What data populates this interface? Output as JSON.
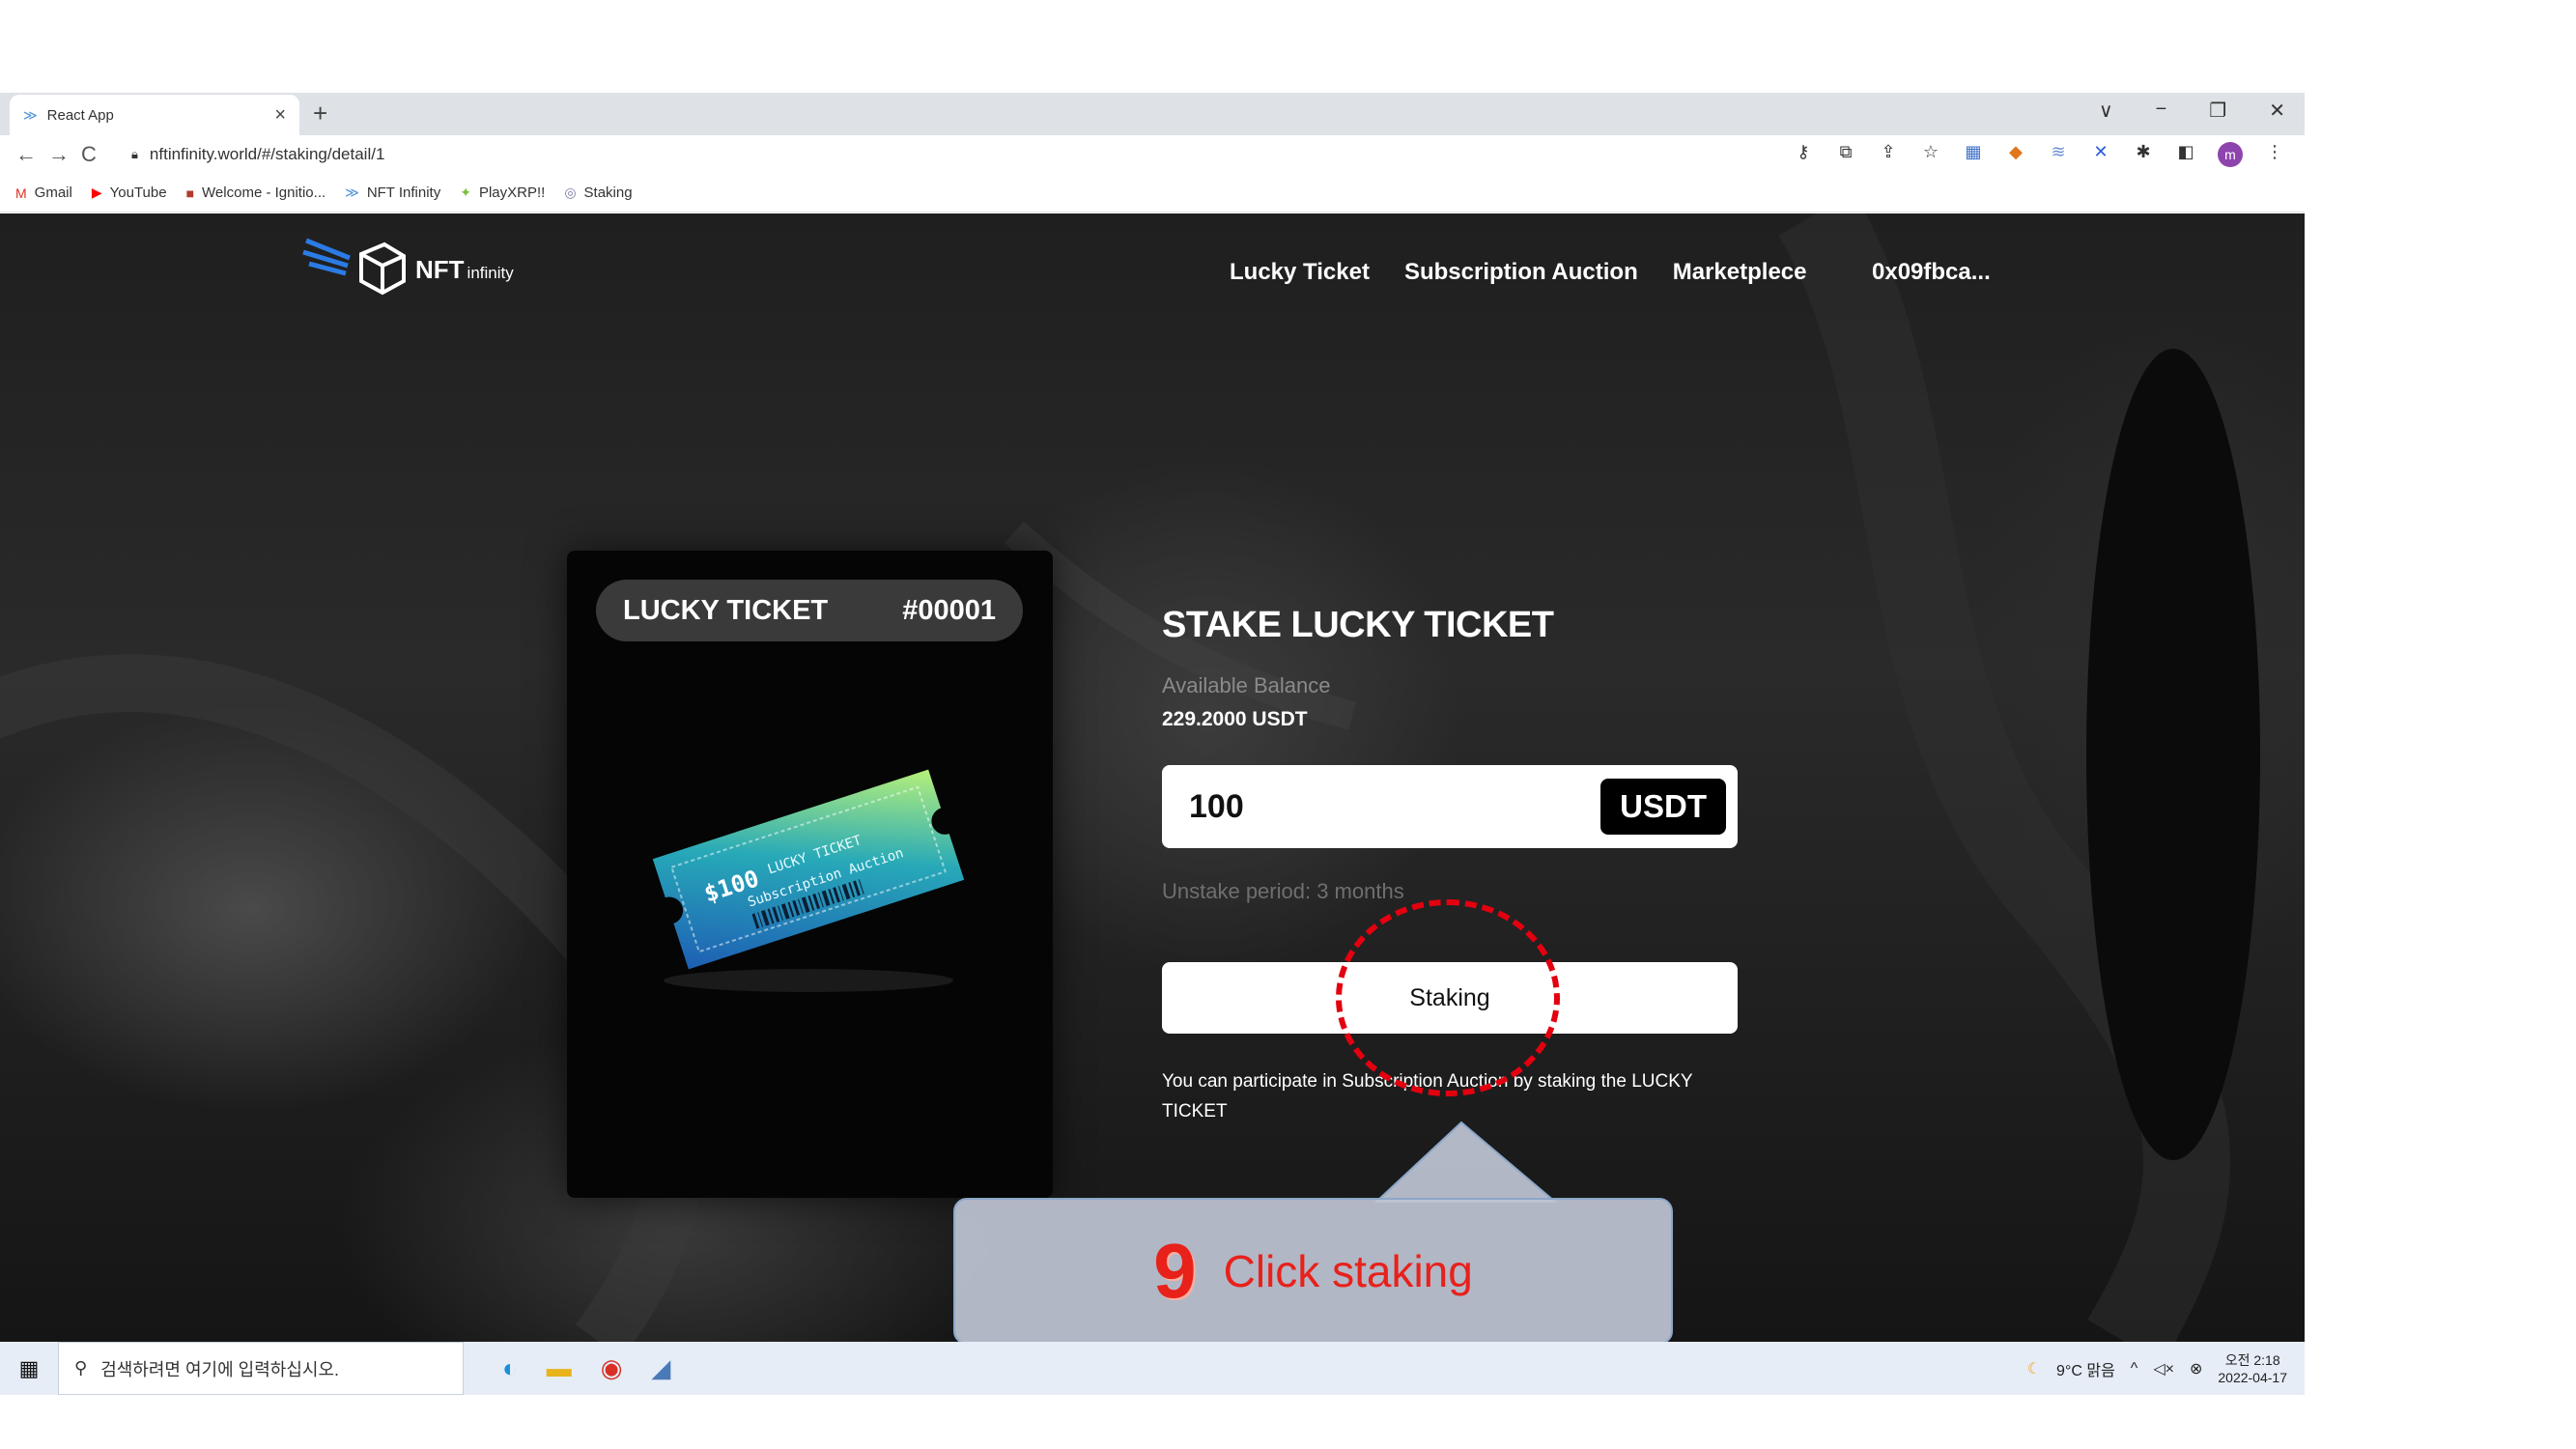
{
  "browser": {
    "tab_title": "React App",
    "tab_close": "×",
    "new_tab": "+",
    "window_controls": [
      "∨",
      "−",
      "❐",
      "✕"
    ],
    "url": "nftinfinity.world/#/staking/detail/1",
    "nav": {
      "back": "←",
      "forward": "→",
      "reload": "C"
    },
    "bookmarks": [
      {
        "label": "Gmail",
        "icon": "gmail-icon",
        "glyph": "M",
        "color": "#d93025"
      },
      {
        "label": "YouTube",
        "icon": "youtube-icon",
        "glyph": "▶",
        "color": "#ff0000"
      },
      {
        "label": "Welcome - Ignitio...",
        "icon": "ignition-icon",
        "glyph": "■",
        "color": "#b03a2e"
      },
      {
        "label": "NFT Infinity",
        "icon": "nft-infinity-icon",
        "glyph": "≫",
        "color": "#4a90d9"
      },
      {
        "label": "PlayXRP!!",
        "icon": "playxrp-icon",
        "glyph": "✦",
        "color": "#7bbf3a"
      },
      {
        "label": "Staking",
        "icon": "staking-bookmark-icon",
        "glyph": "◎",
        "color": "#7a7aa8"
      }
    ],
    "extension_icons": [
      "key-icon",
      "translate-icon",
      "share-icon",
      "star-icon",
      "extension-icon-1",
      "metamask-icon",
      "extension-icon-2",
      "extension-icon-3",
      "puzzle-icon",
      "sidebar-icon",
      "profile-avatar",
      "menu-dots-icon"
    ],
    "profile_initial": "m"
  },
  "site": {
    "logo_brand": "NFT",
    "logo_suffix": "infinity",
    "nav": [
      "Lucky Ticket",
      "Subscription Auction",
      "Marketplece"
    ],
    "wallet": "0x09fbca..."
  },
  "card": {
    "title": "LUCKY TICKET",
    "number": "#00001",
    "ticket_price": "$100",
    "ticket_title": "LUCKY TICKET",
    "ticket_subtitle": "Subscription Auction"
  },
  "stake": {
    "title": "STAKE LUCKY TICKET",
    "balance_label": "Available Balance",
    "balance_value": "229.2000 USDT",
    "amount": "100",
    "unit": "USDT",
    "unstake_period": "Unstake period: 3 months",
    "button": "Staking",
    "note": "You can participate in Subscription Auction by staking the LUCKY TICKET"
  },
  "annotation": {
    "step": "9",
    "text": "Click staking",
    "color": "#e8211b"
  },
  "taskbar": {
    "search_placeholder": "검색하려면 여기에 입력하십시오.",
    "weather": "9°C 맑음",
    "time": "오전 2:18",
    "date": "2022-04-17"
  }
}
